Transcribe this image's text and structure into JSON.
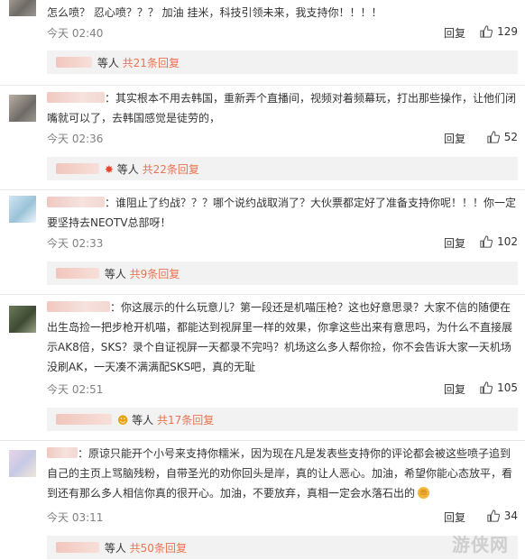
{
  "comments": [
    {
      "text": "怎么喷？ 忍心喷？？？     加油 挂米，科技引领未来，我支持你！！！！",
      "time": "今天 02:40",
      "reply_label": "回复",
      "likes": "129",
      "subreply": {
        "prefix": "等人",
        "count": "共21条回复"
      }
    },
    {
      "text": "：其实根本不用去韩国，重新弄个直播间，视频对着频幕玩，打出那些操作，让他们闭嘴就可以了，去韩国感觉是徒劳的，",
      "time": "今天 02:36",
      "reply_label": "回复",
      "likes": "52",
      "subreply": {
        "prefix": "等人",
        "count": "共22条回复"
      }
    },
    {
      "text": "：谁阻止了约战？？？哪个说约战取消了？大伙票都定好了准备支持你呢！！！你一定要坚持去NEOTV总部呀！",
      "time": "今天 02:33",
      "reply_label": "回复",
      "likes": "102",
      "subreply": {
        "prefix": "等人",
        "count": "共9条回复"
      }
    },
    {
      "text": "：你这展示的什么玩意儿？第一段还是机喵压枪？这也好意思录？大家不信的随便在出生岛捡一把步枪开机喵，都能达到视屏里一样的效果，你拿这些出来有意思吗，为什么不直接展示AK8倍，SKS？录个自证视屏一天都录不完吗？机场这么多人帮你捡，你不会告诉大家一天机场没刷AK，一天凑不满满配SKS吧，真的无耻",
      "time": "今天 02:51",
      "reply_label": "回复",
      "likes": "105",
      "subreply": {
        "prefix": "等人",
        "count": "共17条回复"
      }
    },
    {
      "text": "：原谅只能开个小号来支持你糯米，因为现在凡是发表些支持你的评论都会被这些喷子追到自己的主页上骂脑残粉，自带圣光的劝你回头是岸，真的让人恶心。加油，希望你能心态放平，看到还有那么多人相信你真的很开心。加油，不要放弃，真相一定会水落石出的",
      "time": "今天 03:11",
      "reply_label": "回复",
      "likes": "34",
      "subreply": {
        "prefix": "等人",
        "count": "共50条回复"
      }
    }
  ],
  "watermark": "游侠网",
  "colors": {
    "count": "#eb7350",
    "subreply_bg": "#f2f2f2",
    "divider": "#e6e6e6"
  }
}
